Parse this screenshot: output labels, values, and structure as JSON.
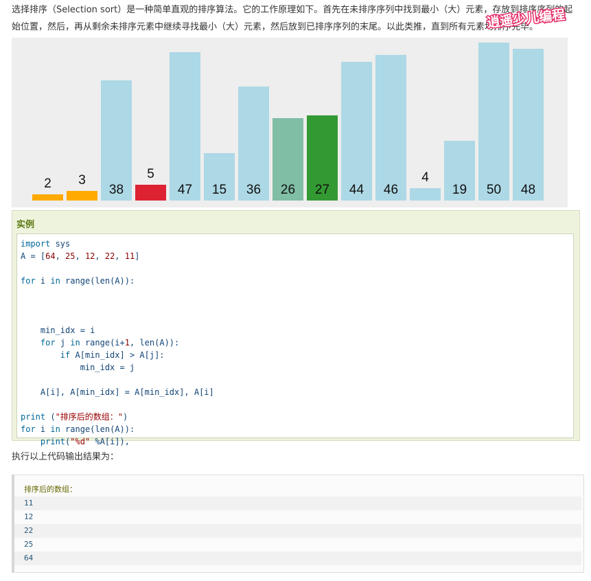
{
  "intro": {
    "text": "选择排序（Selection sort）是一种简单直观的排序算法。它的工作原理如下。首先在未排序序列中找到最小（大）元素，存放到排序序列的起始位置，然后，再从剩余未排序元素中继续寻找最小（大）元素，然后放到已排序序列的末尾。以此类推，直到所有元素均排序完毕。"
  },
  "watermark": {
    "text": "逍遥少儿编程"
  },
  "chart_data": {
    "type": "bar",
    "categories": [
      "2",
      "3",
      "38",
      "5",
      "47",
      "15",
      "36",
      "26",
      "27",
      "44",
      "46",
      "4",
      "19",
      "50",
      "48"
    ],
    "values": [
      2,
      3,
      38,
      5,
      47,
      15,
      36,
      26,
      27,
      44,
      46,
      4,
      19,
      50,
      48
    ],
    "ylim": [
      0,
      50
    ],
    "grid": false,
    "colors": [
      "#ffaa00",
      "#ffaa00",
      "#add8e6",
      "#dd2233",
      "#add8e6",
      "#add8e6",
      "#add8e6",
      "#80bea5",
      "#339933",
      "#add8e6",
      "#add8e6",
      "#add8e6",
      "#add8e6",
      "#add8e6",
      "#add8e6"
    ]
  },
  "example": {
    "title": "实例",
    "code": [
      [
        [
          "kw",
          "import"
        ],
        [
          "pl",
          " sys"
        ]
      ],
      [
        [
          "pl",
          "A = ["
        ],
        [
          "num",
          "64"
        ],
        [
          "pl",
          ", "
        ],
        [
          "num",
          "25"
        ],
        [
          "pl",
          ", "
        ],
        [
          "num",
          "12"
        ],
        [
          "pl",
          ", "
        ],
        [
          "num",
          "22"
        ],
        [
          "pl",
          ", "
        ],
        [
          "num",
          "11"
        ],
        [
          "pl",
          "]"
        ]
      ],
      [],
      [
        [
          "kw",
          "for"
        ],
        [
          "pl",
          " i "
        ],
        [
          "kw",
          "in"
        ],
        [
          "pl",
          " range(len(A)):"
        ]
      ],
      [],
      [],
      [],
      [
        [
          "pl",
          "    min_idx = i"
        ]
      ],
      [
        [
          "pl",
          "    "
        ],
        [
          "kw",
          "for"
        ],
        [
          "pl",
          " j "
        ],
        [
          "kw",
          "in"
        ],
        [
          "pl",
          " range(i+"
        ],
        [
          "num",
          "1"
        ],
        [
          "pl",
          ", len(A)):"
        ]
      ],
      [
        [
          "pl",
          "        "
        ],
        [
          "kw",
          "if"
        ],
        [
          "pl",
          " A[min_idx] > A[j]:"
        ]
      ],
      [
        [
          "pl",
          "            min_idx = j"
        ]
      ],
      [],
      [
        [
          "pl",
          "    A[i], A[min_idx] = A[min_idx], A[i]"
        ]
      ],
      [],
      [
        [
          "kw",
          "print"
        ],
        [
          "pl",
          " ("
        ],
        [
          "str",
          "\"排序后的数组：\""
        ],
        [
          "pl",
          ")"
        ]
      ],
      [
        [
          "kw",
          "for"
        ],
        [
          "pl",
          " i "
        ],
        [
          "kw",
          "in"
        ],
        [
          "pl",
          " range(len(A)):"
        ]
      ],
      [
        [
          "pl",
          "    "
        ],
        [
          "kw",
          "print"
        ],
        [
          "pl",
          "("
        ],
        [
          "str",
          "\"%d\""
        ],
        [
          "pl",
          " %A[i]),"
        ]
      ]
    ]
  },
  "result": {
    "label": "执行以上代码输出结果为：",
    "lines": [
      "排序后的数组：",
      "11",
      "12",
      "22",
      "25",
      "64"
    ]
  }
}
